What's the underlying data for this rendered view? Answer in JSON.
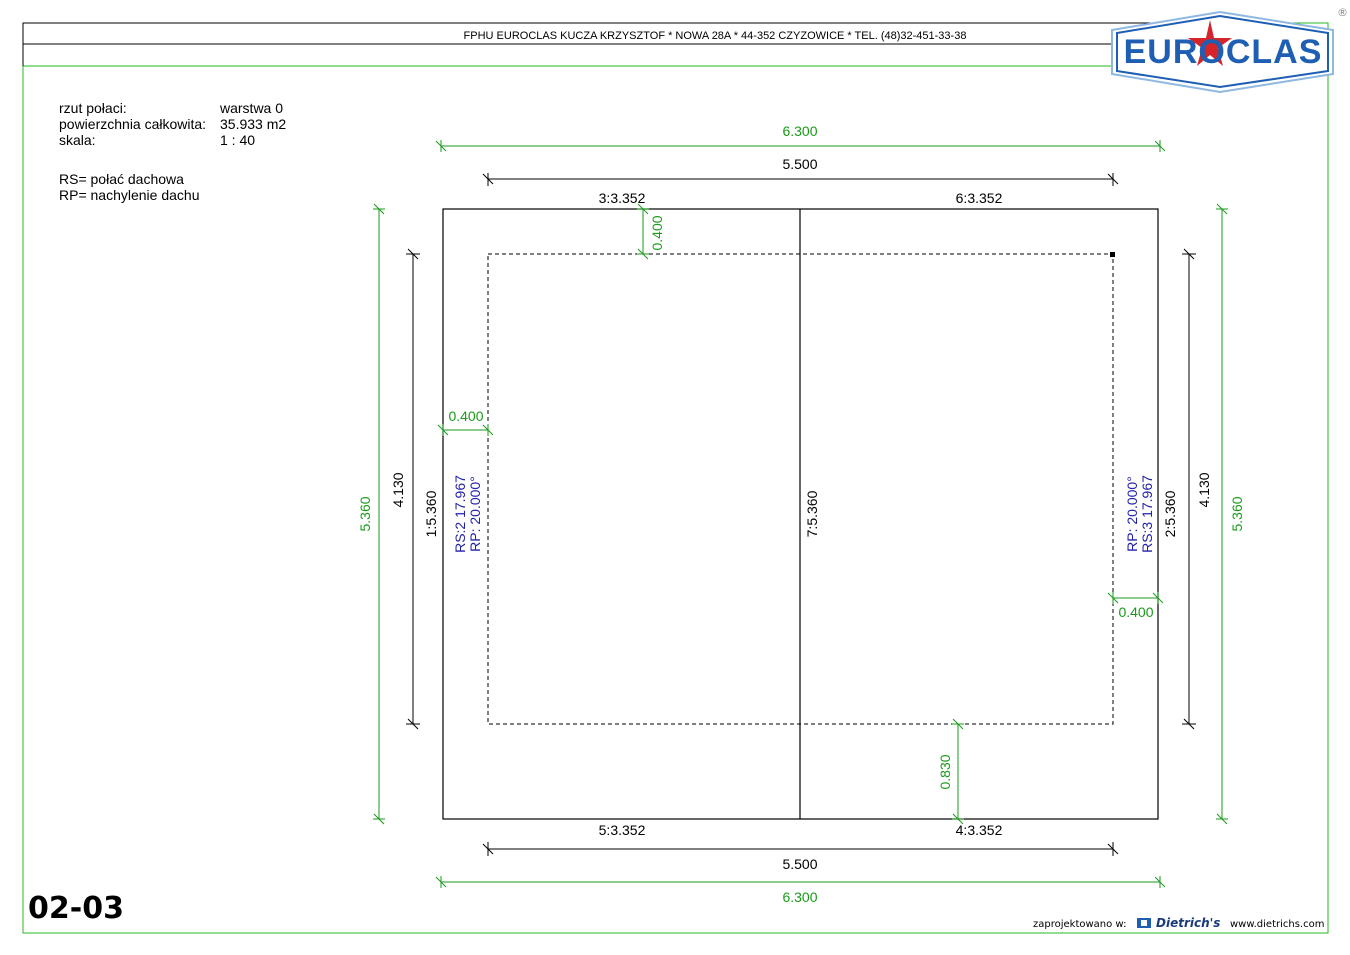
{
  "header": {
    "company_line": "FPHU EUROCLAS KUCZA KRZYSZTOF * NOWA 28A * 44-352 CZYZOWICE * TEL. (48)32-451-33-38"
  },
  "logo": {
    "text": "EUROCLAS",
    "registered_mark": "®"
  },
  "info": {
    "rows": [
      {
        "label": "rzut połaci:",
        "value": "warstwa 0"
      },
      {
        "label": "powierzchnia całkowita:",
        "value": "35.933 m2"
      },
      {
        "label": "skala:",
        "value": "1 : 40"
      }
    ],
    "legend": [
      "RS= połać dachowa",
      "RP= nachylenie dachu"
    ]
  },
  "drawing": {
    "dim_top_overall": "6.300",
    "dim_top_inner": "5.500",
    "edge_top_left": "3:3.352",
    "edge_top_right": "6:3.352",
    "edge_bottom_left": "5:3.352",
    "edge_bottom_right": "4:3.352",
    "dim_bottom_inner": "5.500",
    "dim_bottom_overall": "6.300",
    "dim_left_overall": "5.360",
    "dim_left_inner": "4.130",
    "edge_left": "1:5.360",
    "edge_middle": "7:5.360",
    "edge_right": "2:5.360",
    "dim_right_inner": "4.130",
    "dim_right_overall": "5.360",
    "overhang_top": "0.400",
    "overhang_left": "0.400",
    "overhang_right": "0.400",
    "overhang_bottom": "0.830",
    "left_face": {
      "rs": "RS:2   17.967",
      "rp": "RP:   20.000°"
    },
    "right_face": {
      "rs": "RS:3   17.967",
      "rp": "RP:   20.000°"
    }
  },
  "footer": {
    "sheet_number": "02-03",
    "designed_with": "zaprojektowano w:",
    "software": "Dietrich's",
    "url": "www.dietrichs.com"
  },
  "colors": {
    "border_green": "#22bb22",
    "dim_green": "#1a9a1a",
    "annotation_blue": "#2222aa",
    "logo_blue": "#1f5fb3",
    "logo_red": "#d6252a"
  }
}
